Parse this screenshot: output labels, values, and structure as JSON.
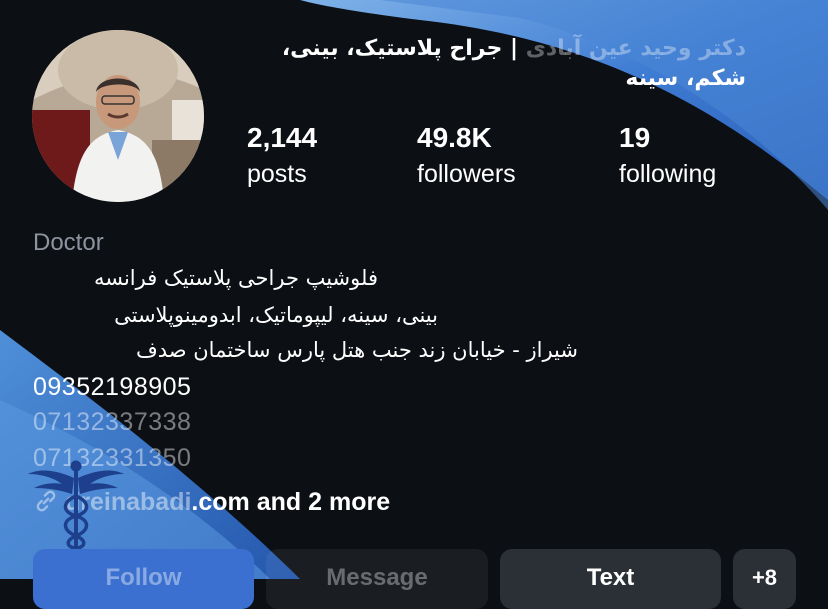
{
  "profile": {
    "name_faded": "دکتر وحید عین آبادی",
    "name_separator": " | ",
    "name_main": "جراح پلاستیک، بینی، شکم، سینه"
  },
  "stats": {
    "posts": {
      "value": "2,144",
      "label": "posts"
    },
    "followers": {
      "value": "49.8K",
      "label": "followers"
    },
    "following": {
      "value": "19",
      "label": "following"
    }
  },
  "bio": {
    "category": "Doctor",
    "lines": [
      "فلوشیپ جراحی پلاستیک فرانسه",
      "بینی، سینه، لیپوماتیک، ابدومینوپلاستی",
      "شیراز - خیابان زند جنب هتل پارس ساختمان صدف"
    ],
    "phones": [
      "09352198905",
      "07132337338",
      "07132331350"
    ],
    "link_faded": "dreinabadi",
    "link_text": ".com and 2 more"
  },
  "buttons": {
    "follow": "Follow",
    "message": "Message",
    "text": "Text",
    "more": "+8"
  },
  "colors": {
    "background": "#0c0f14",
    "accent_blue": "#3b70d0",
    "button_gray": "#2b2f36",
    "category_gray": "#8e949e"
  },
  "icons": {
    "link": "link-icon",
    "logo": "caduceus-icon"
  }
}
